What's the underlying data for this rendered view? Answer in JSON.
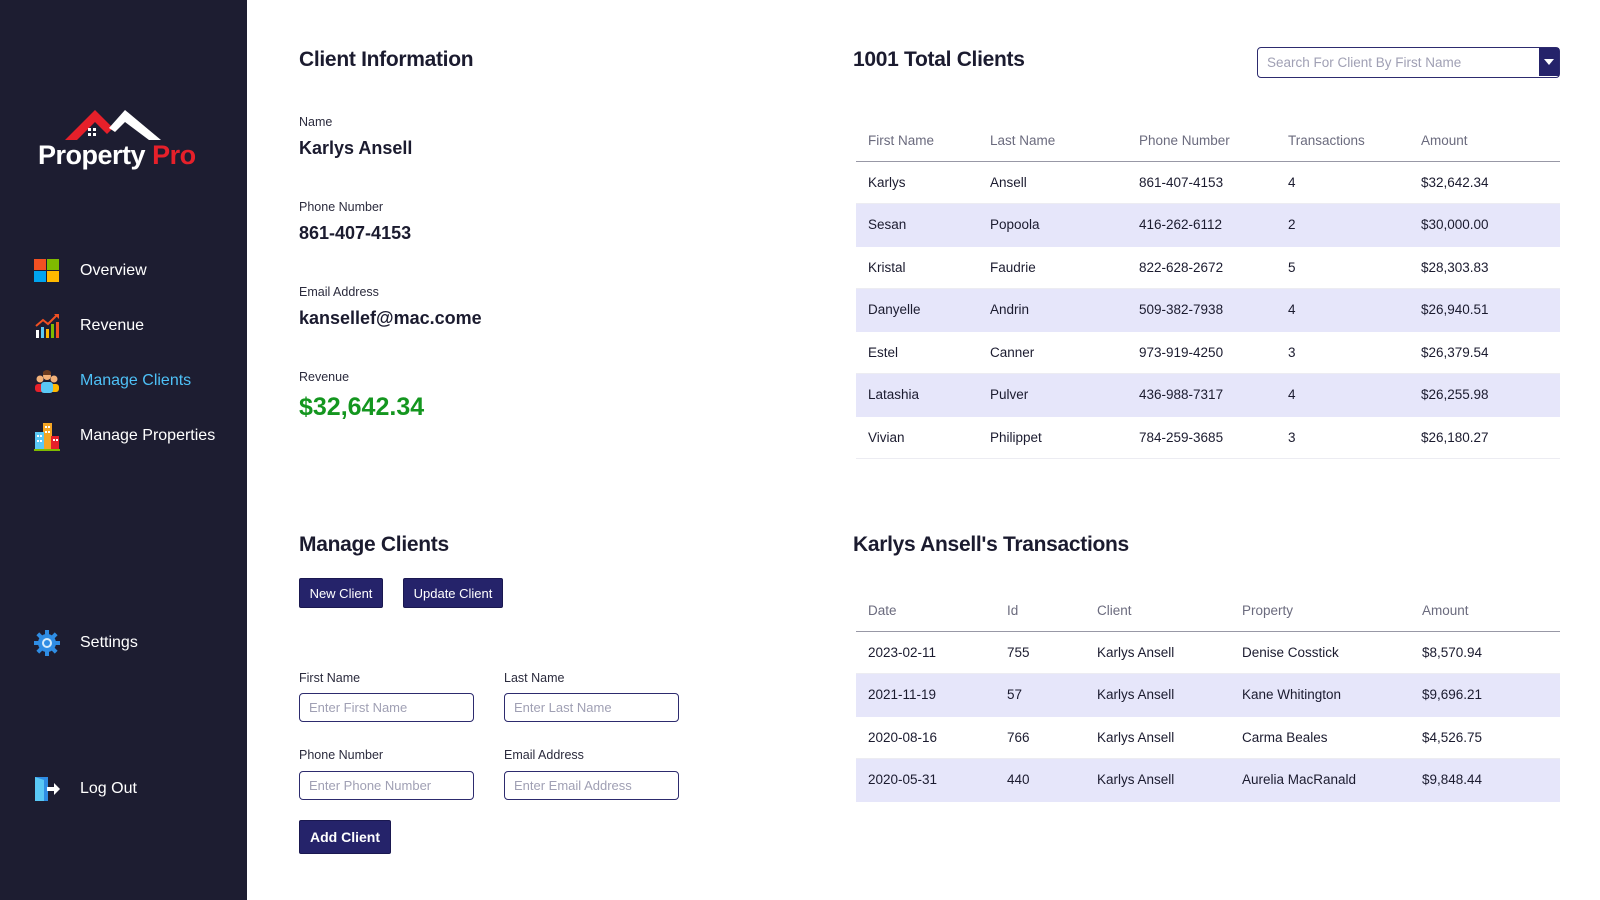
{
  "app": {
    "logo_part1": "Property",
    "logo_part2": "Pro"
  },
  "sidebar": {
    "items": [
      {
        "label": "Overview",
        "icon": "windows-grid-icon"
      },
      {
        "label": "Revenue",
        "icon": "bar-chart-icon"
      },
      {
        "label": "Manage Clients",
        "icon": "users-icon",
        "active": true
      },
      {
        "label": "Manage Properties",
        "icon": "buildings-icon"
      }
    ],
    "settings_label": "Settings",
    "logout_label": "Log Out"
  },
  "client_info": {
    "title": "Client Information",
    "name_label": "Name",
    "name_value": "Karlys Ansell",
    "phone_label": "Phone Number",
    "phone_value": "861-407-4153",
    "email_label": "Email Address",
    "email_value": "kansellef@mac.come",
    "revenue_label": "Revenue",
    "revenue_value": "$32,642.34"
  },
  "manage": {
    "title": "Manage Clients",
    "new_client_label": "New Client",
    "update_client_label": "Update Client",
    "first_name_label": "First Name",
    "first_name_placeholder": "Enter First Name",
    "last_name_label": "Last Name",
    "last_name_placeholder": "Enter Last Name",
    "phone_label": "Phone Number",
    "phone_placeholder": "Enter Phone Number",
    "email_label": "Email Address",
    "email_placeholder": "Enter Email Address",
    "add_client_label": "Add Client"
  },
  "clients": {
    "title": "1001 Total Clients",
    "search_placeholder": "Search For Client By First Name",
    "columns": [
      "First Name",
      "Last Name",
      "Phone Number",
      "Transactions",
      "Amount"
    ],
    "rows": [
      [
        "Karlys",
        "Ansell",
        "861-407-4153",
        "4",
        "$32,642.34"
      ],
      [
        "Sesan",
        "Popoola",
        "416-262-6112",
        "2",
        "$30,000.00"
      ],
      [
        "Kristal",
        "Faudrie",
        "822-628-2672",
        "5",
        "$28,303.83"
      ],
      [
        "Danyelle",
        "Andrin",
        "509-382-7938",
        "4",
        "$26,940.51"
      ],
      [
        "Estel",
        "Canner",
        "973-919-4250",
        "3",
        "$26,379.54"
      ],
      [
        "Latashia",
        "Pulver",
        "436-988-7317",
        "4",
        "$26,255.98"
      ],
      [
        "Vivian",
        "Philippet",
        "784-259-3685",
        "3",
        "$26,180.27"
      ]
    ]
  },
  "transactions": {
    "title": "Karlys Ansell's Transactions",
    "columns": [
      "Date",
      "Id",
      "Client",
      "Property",
      "Amount"
    ],
    "rows": [
      [
        "2023-02-11",
        "755",
        "Karlys Ansell",
        "Denise Cosstick",
        "$8,570.94"
      ],
      [
        "2021-11-19",
        "57",
        "Karlys Ansell",
        "Kane Whitington",
        "$9,696.21"
      ],
      [
        "2020-08-16",
        "766",
        "Karlys Ansell",
        "Carma Beales",
        "$4,526.75"
      ],
      [
        "2020-05-31",
        "440",
        "Karlys Ansell",
        "Aurelia MacRanald",
        "$9,848.44"
      ]
    ]
  },
  "colors": {
    "sidebar_bg": "#1d1d31",
    "accent": "#25236a",
    "active_nav": "#4ec1f7",
    "revenue_green": "#14961f",
    "row_highlight": "#e6e6fa",
    "logo_red": "#e6202a"
  }
}
